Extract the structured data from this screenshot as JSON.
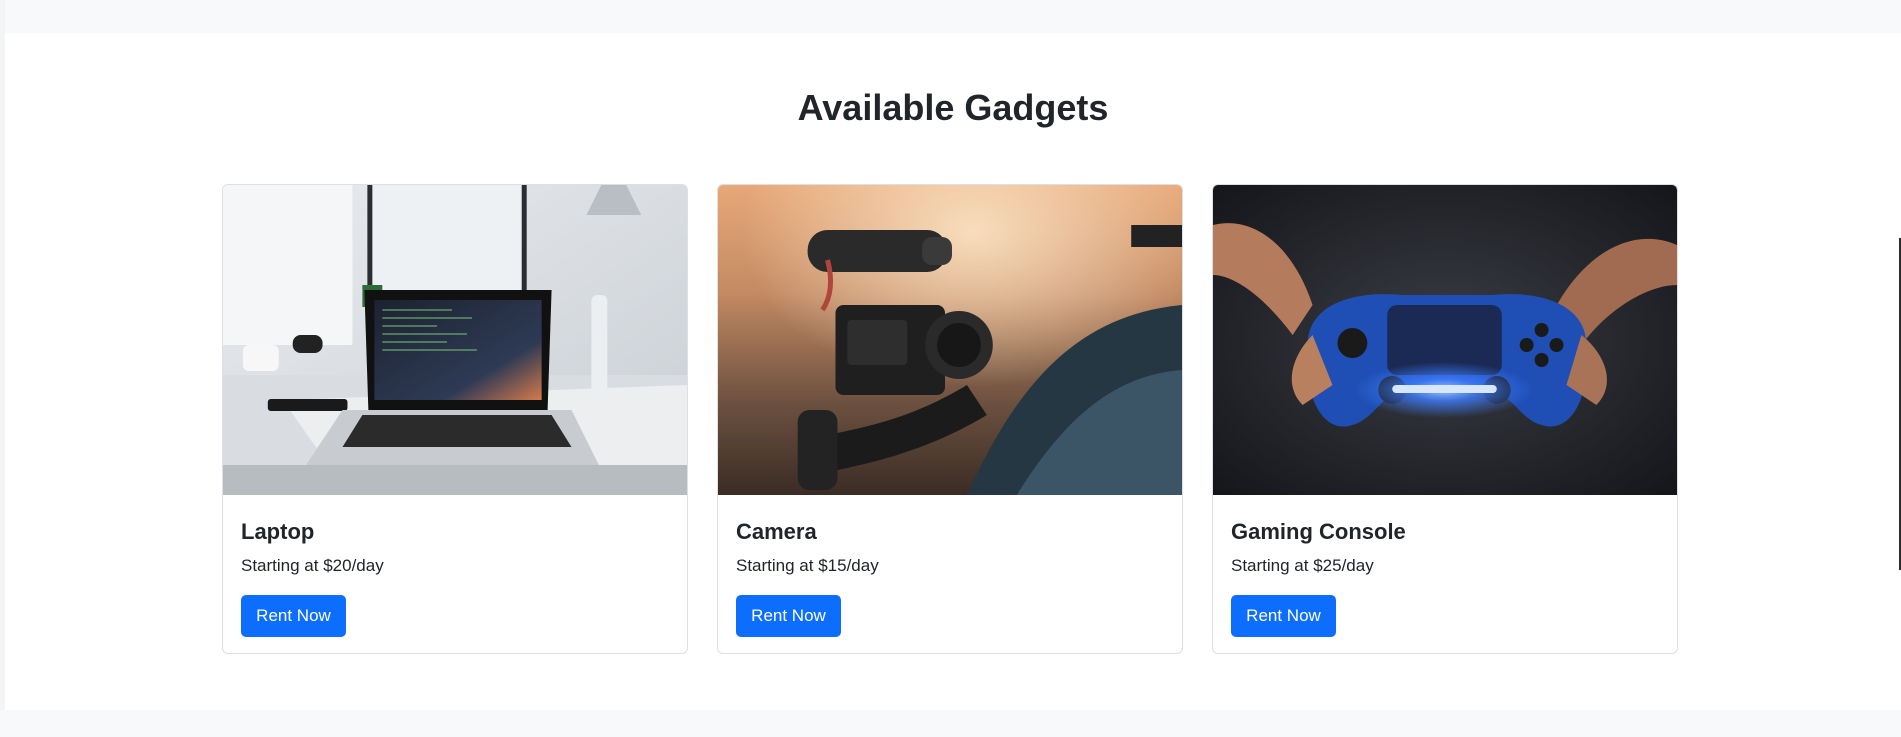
{
  "section": {
    "title": "Available Gadgets"
  },
  "gadgets": [
    {
      "name": "Laptop",
      "price_text": "Starting at $20/day",
      "button_label": "Rent Now",
      "image": "laptop-on-desk-photo"
    },
    {
      "name": "Camera",
      "price_text": "Starting at $15/day",
      "button_label": "Rent Now",
      "image": "camera-on-gimbal-photo"
    },
    {
      "name": "Gaming Console",
      "price_text": "Starting at $25/day",
      "button_label": "Rent Now",
      "image": "game-controller-photo"
    }
  ],
  "colors": {
    "primary_button": "#0d6efd",
    "page_background": "#f8f9fa",
    "card_border": "#dcdfe3"
  }
}
